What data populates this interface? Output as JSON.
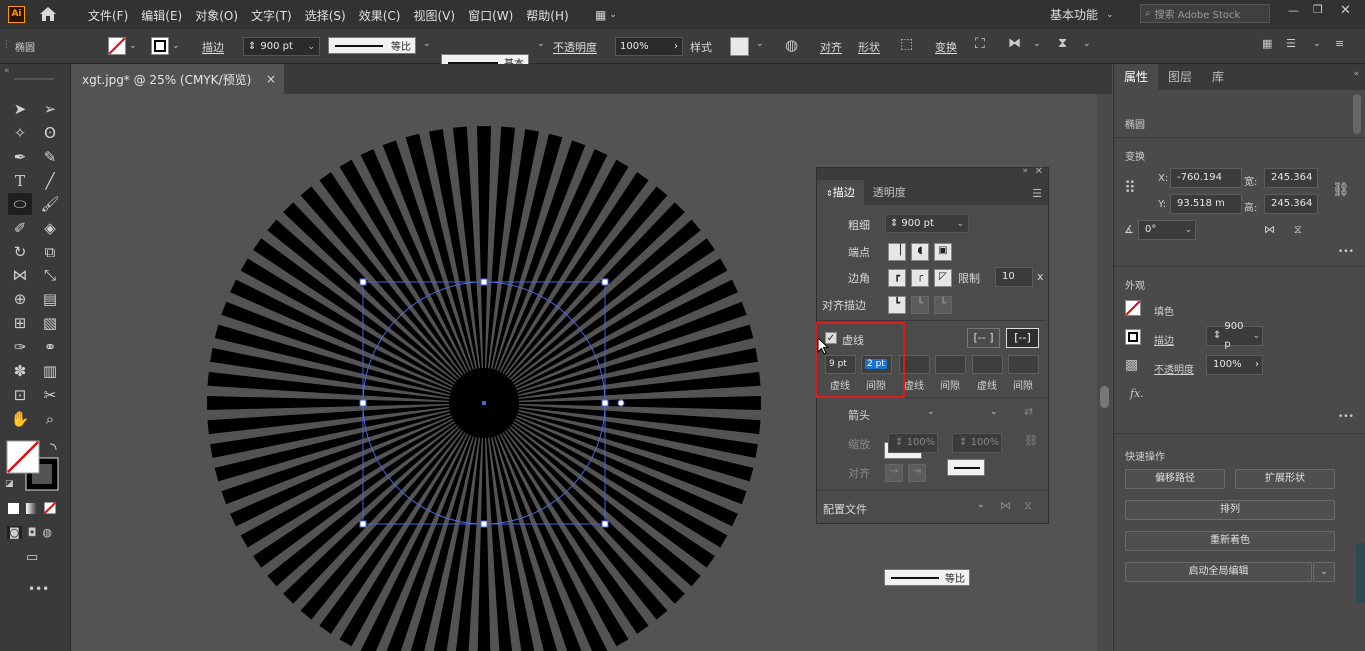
{
  "app": {
    "logo": "Ai",
    "home_icon": "home-icon"
  },
  "menu": [
    "文件(F)",
    "编辑(E)",
    "对象(O)",
    "文字(T)",
    "选择(S)",
    "效果(C)",
    "视图(V)",
    "窗口(W)",
    "帮助(H)"
  ],
  "workspace": {
    "label": "基本功能",
    "search_placeholder": "搜索 Adobe Stock"
  },
  "optionsbar": {
    "object_type": "椭圆",
    "stroke_label": "描边",
    "stroke_weight": "900 pt",
    "profile_label": "等比",
    "brush_label": "基本",
    "opacity_label": "不透明度",
    "opacity_value": "100%",
    "style_label": "样式",
    "align_label": "对齐",
    "shape_label": "形状",
    "transform_label": "变换"
  },
  "document": {
    "tab_title": "xgt.jpg* @ 25% (CMYK/预览)",
    "close": "×"
  },
  "artwork": {
    "rays": 72,
    "fill_color": "#000000",
    "selection_color": "#4a66d8"
  },
  "stroke_panel": {
    "tabs": [
      "描边",
      "透明度"
    ],
    "weight_label": "粗细",
    "weight_value": "900 pt",
    "cap_label": "端点",
    "corner_label": "边角",
    "limit_label": "限制",
    "limit_value": "10",
    "limit_unit": "x",
    "align_label": "对齐描边",
    "dashed_label": "虚线",
    "dashed_checked": true,
    "dash_values": [
      "9 pt",
      "2 pt",
      "",
      "",
      "",
      ""
    ],
    "dash_labels": [
      "虚线",
      "间隙",
      "虚线",
      "间隙",
      "虚线",
      "间隙"
    ],
    "arrow_label": "箭头",
    "scale_label": "缩放",
    "scale_value_1": "100%",
    "scale_value_2": "100%",
    "arrow_align_label": "对齐",
    "profile_label": "配置文件",
    "profile_value": "等比"
  },
  "properties": {
    "tabs": [
      "属性",
      "图层",
      "库"
    ],
    "object_type": "椭圆",
    "transform_title": "变换",
    "x_label": "X:",
    "x_value": "-760.194",
    "y_label": "Y:",
    "y_value": "93.518 m",
    "w_label": "宽:",
    "w_value": "245.364",
    "h_label": "高:",
    "h_value": "245.364",
    "angle_value": "0°",
    "appearance_title": "外观",
    "fill_label": "填色",
    "stroke_label": "描边",
    "stroke_value": "900 p",
    "opacity_label": "不透明度",
    "opacity_value": "100%",
    "fx_label": "fx.",
    "quick_title": "快速操作",
    "btn_offset_path": "偏移路径",
    "btn_expand_shape": "扩展形状",
    "btn_arrange": "排列",
    "btn_recolor": "重新着色",
    "btn_global_edit": "启动全局编辑",
    "more": "•••"
  }
}
